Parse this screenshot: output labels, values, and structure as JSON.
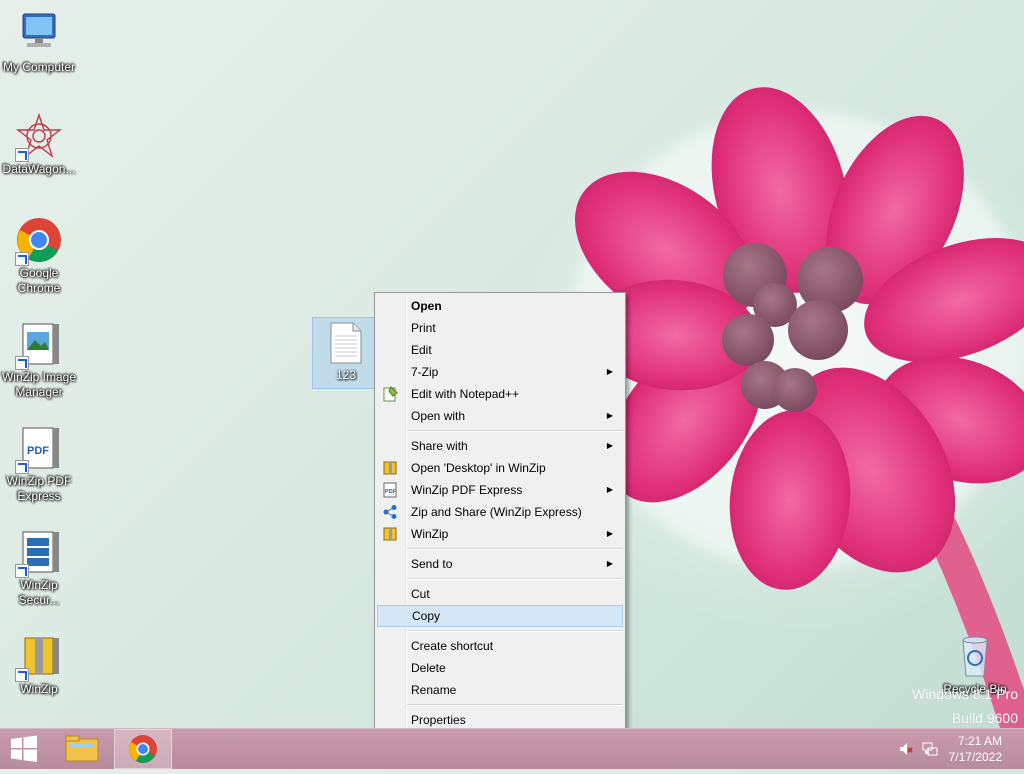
{
  "desktop": {
    "icons": [
      {
        "label": "My Computer"
      },
      {
        "label": "DataWagon..."
      },
      {
        "label": "Google Chrome"
      },
      {
        "label": "WinZip Image Manager"
      },
      {
        "label": "WinZip PDF Express"
      },
      {
        "label": "WinZip Secur..."
      },
      {
        "label": "WinZip"
      },
      {
        "label": "Recycle Bin"
      }
    ],
    "selected_file": {
      "label": "123"
    },
    "watermark": {
      "line1": "Windows 8.1 Pro",
      "line2": "Build 9600"
    }
  },
  "context_menu": {
    "items": [
      {
        "label": "Open",
        "bold": true
      },
      {
        "label": "Print"
      },
      {
        "label": "Edit"
      },
      {
        "label": "7-Zip",
        "submenu": true
      },
      {
        "label": "Edit with Notepad++",
        "icon": "notepad-plus-icon"
      },
      {
        "label": "Open with",
        "submenu": true
      },
      {
        "label": "Share with",
        "submenu": true
      },
      {
        "label": "Open 'Desktop' in WinZip",
        "icon": "winzip-icon"
      },
      {
        "label": "WinZip PDF Express",
        "icon": "pdf-icon",
        "submenu": true
      },
      {
        "label": "Zip and Share (WinZip Express)",
        "icon": "share-icon"
      },
      {
        "label": "WinZip",
        "icon": "winzip-icon",
        "submenu": true
      },
      {
        "label": "Send to",
        "submenu": true
      },
      {
        "label": "Cut"
      },
      {
        "label": "Copy",
        "highlighted": true
      },
      {
        "label": "Create shortcut"
      },
      {
        "label": "Delete"
      },
      {
        "label": "Rename"
      },
      {
        "label": "Properties"
      }
    ],
    "submenu_arrow": "▶"
  },
  "taskbar": {
    "time": "7:21 AM",
    "date": "7/17/2022"
  },
  "colors": {
    "menu_bg": "#f0f0f0",
    "menu_highlight": "#d5e7f7",
    "taskbar": "#c294a6",
    "flower": "#e0307a"
  }
}
